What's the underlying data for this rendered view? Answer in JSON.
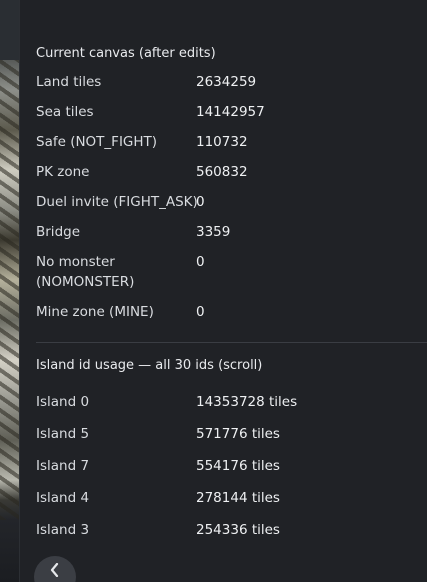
{
  "canvas_stats": {
    "title": "Current canvas (after edits)",
    "rows": [
      {
        "label": "Land tiles",
        "value": "2634259"
      },
      {
        "label": "Sea tiles",
        "value": "14142957"
      },
      {
        "label": "Safe (NOT_FIGHT)",
        "value": "110732"
      },
      {
        "label": "PK zone",
        "value": "560832"
      },
      {
        "label": "Duel invite (FIGHT_ASK)",
        "value": "0"
      },
      {
        "label": "Bridge",
        "value": "3359"
      },
      {
        "label": "No monster",
        "label2": "(NOMONSTER)",
        "value": "0"
      },
      {
        "label": "Mine zone (MINE)",
        "value": "0"
      }
    ]
  },
  "island_usage": {
    "title": "Island id usage — all 30 ids (scroll)",
    "rows": [
      {
        "label": "Island 0",
        "value": "14353728 tiles"
      },
      {
        "label": "Island 5",
        "value": "571776 tiles"
      },
      {
        "label": "Island 7",
        "value": "554176 tiles"
      },
      {
        "label": "Island 4",
        "value": "278144 tiles"
      },
      {
        "label": "Island 3",
        "value": "254336 tiles"
      }
    ]
  },
  "icons": {
    "back": "chevron-left-icon"
  }
}
